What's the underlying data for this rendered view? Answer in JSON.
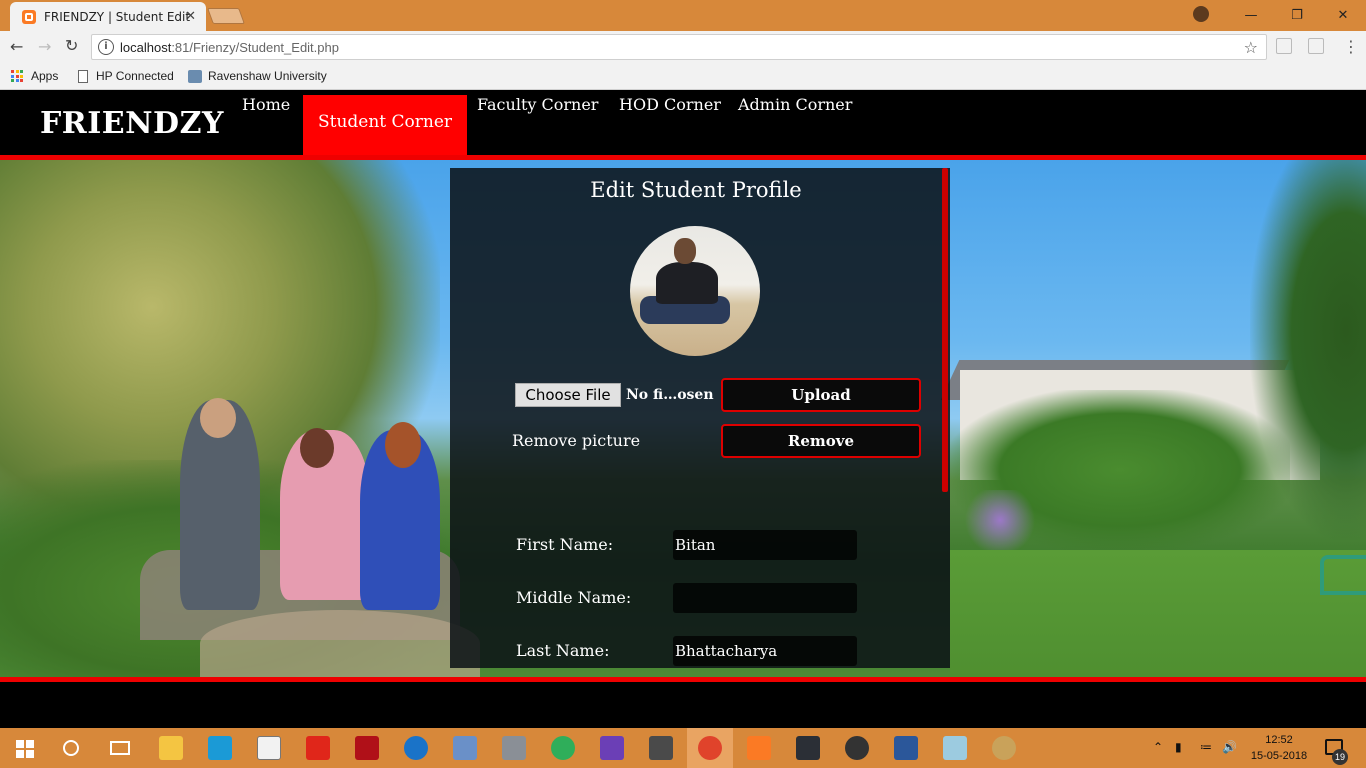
{
  "browser": {
    "tab_title": "FRIENDZY | Student Edit",
    "tab_close": "✕",
    "url_host": "localhost",
    "url_rest": ":81/Frienzy/Student_Edit.php",
    "window_controls": {
      "minimize": "—",
      "restore": "❐",
      "close": "✕"
    },
    "bookmarks": [
      {
        "label": "Apps",
        "icon": "apps-grid-icon"
      },
      {
        "label": "HP Connected",
        "icon": "page-icon"
      },
      {
        "label": "Ravenshaw University",
        "icon": "site-icon"
      }
    ]
  },
  "site": {
    "logo": "FRIENDZY",
    "nav": {
      "home": "Home",
      "student": "Student Corner",
      "faculty": "Faculty Corner",
      "hod": "HOD Corner",
      "admin": "Admin Corner"
    },
    "accent_color": "#ff0000"
  },
  "panel": {
    "title": "Edit Student Profile",
    "file_button": "Choose File",
    "file_status": "No fi…osen",
    "upload_button": "Upload",
    "remove_label": "Remove picture",
    "remove_button": "Remove",
    "fields": [
      {
        "label": "First Name:",
        "value": "Bitan"
      },
      {
        "label": "Middle Name:",
        "value": ""
      },
      {
        "label": "Last Name:",
        "value": "Bhattacharya"
      }
    ]
  },
  "taskbar": {
    "clock_time": "12:52",
    "clock_date": "15-05-2018",
    "notification_count": "19"
  }
}
